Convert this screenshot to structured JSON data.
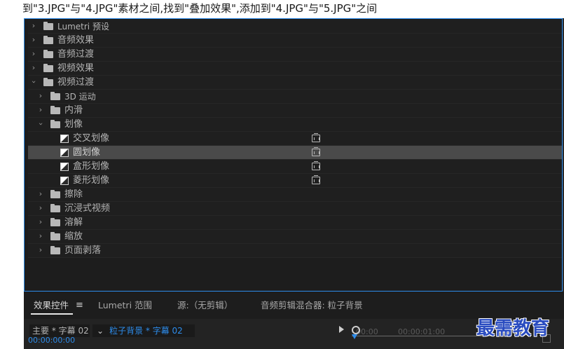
{
  "instruction": "到\"3.JPG\"与\"4.JPG\"素材之间,找到\"叠加效果\",添加到\"4.JPG\"与\"5.JPG\"之间",
  "tree": {
    "lumetri_presets": "Lumetri 预设",
    "audio_effects": "音频效果",
    "audio_transitions": "音频过渡",
    "video_effects": "视频效果",
    "video_transitions": "视频过渡",
    "motion_3d": "3D 运动",
    "dissolve_slide": "内滑",
    "iris": "划像",
    "iris_cross": "交叉划像",
    "iris_round": "圆划像",
    "iris_box": "盒形划像",
    "iris_diamond": "菱形划像",
    "wipe": "擦除",
    "immersive_video": "沉浸式视频",
    "dissolve": "溶解",
    "zoom": "缩放",
    "page_peel": "页面剥落"
  },
  "tabs": {
    "effect_controls": "效果控件",
    "effect_controls_menu": "≡",
    "lumetri_scopes": "Lumetri 范围",
    "source": "源:（无剪辑）",
    "audio_mixer": "音频剪辑混合器: 粒子背景"
  },
  "controls": {
    "master_clip": "主要 * 字幕 02",
    "sequence_clip": "粒子背景 * 字幕 02",
    "timecode": "00:00:00:00",
    "ruler_time_1": "00:00",
    "ruler_time_2": "00:00:01:00"
  },
  "watermark": "最需教育",
  "colors": {
    "accent": "#2d8ceb",
    "panel_bg": "#1d1d1d",
    "selected_row": "#4a4a4a",
    "watermark": "#2a4cc0"
  },
  "selected_item": "iris_round"
}
